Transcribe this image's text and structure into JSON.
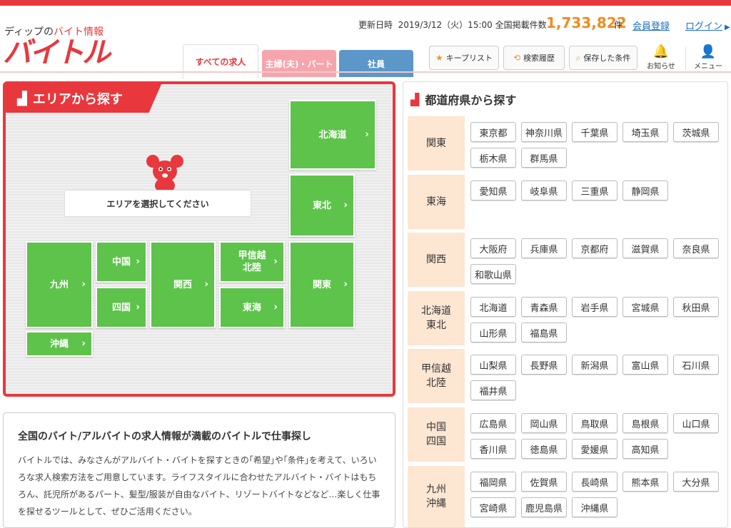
{
  "header": {
    "logo_sub_prefix": "ディップの",
    "logo_sub_red": "バイト情報",
    "logo_main": "バイトル",
    "update_label": "更新日時",
    "update_date": "2019/3/12（火）15:00",
    "count_label": "全国掲載件数",
    "count_value": "1,733,822",
    "count_unit": "件",
    "register": "会員登録",
    "login": "ログイン",
    "tabs": [
      "すべての求人",
      "主婦(夫)・パート",
      "社員"
    ],
    "tools": [
      "キープリスト",
      "検索履歴",
      "保存した条件"
    ],
    "notice": "お知らせ",
    "menu": "メニュー",
    "colors": {
      "brand": "#e8383d",
      "count": "#f08c1e",
      "link": "#1d6fc2"
    }
  },
  "area": {
    "title": "エリアから探す",
    "select_msg": "エリアを選択してください",
    "regions": {
      "hokkaido": "北海道",
      "tohoku": "東北",
      "kanto": "関東",
      "koshinetsu_1": "甲信越",
      "koshinetsu_2": "北陸",
      "tokai": "東海",
      "kansai": "関西",
      "chugoku": "中国",
      "shikoku": "四国",
      "kyushu": "九州",
      "okinawa": "沖縄"
    },
    "region_color": "#5dc34a"
  },
  "info": {
    "title": "全国のバイト/アルバイトの求人情報が満載のバイトルで仕事探し",
    "body": "バイトルでは、みなさんがアルバイト・バイトを探すときの｢希望｣や｢条件｣を考えて、いろいろな求人検索方法をご用意しています。ライフスタイルに合わせたアルバイト・バイトはもちろん、託児所があるパート、髪型/服装が自由なバイト、リゾートバイトなどなど…楽しく仕事を探せるツールとして、ぜひご活用ください。"
  },
  "prefs": {
    "title": "都道府県から探す",
    "groups": [
      {
        "label": "関東",
        "items": [
          "東京都",
          "神奈川県",
          "千葉県",
          "埼玉県",
          "茨城県",
          "栃木県",
          "群馬県"
        ]
      },
      {
        "label": "東海",
        "items": [
          "愛知県",
          "岐阜県",
          "三重県",
          "静岡県"
        ]
      },
      {
        "label": "関西",
        "items": [
          "大阪府",
          "兵庫県",
          "京都府",
          "滋賀県",
          "奈良県",
          "和歌山県"
        ]
      },
      {
        "label": "北海道\n東北",
        "items": [
          "北海道",
          "青森県",
          "岩手県",
          "宮城県",
          "秋田県",
          "山形県",
          "福島県"
        ]
      },
      {
        "label": "甲信越\n北陸",
        "items": [
          "山梨県",
          "長野県",
          "新潟県",
          "富山県",
          "石川県",
          "福井県"
        ]
      },
      {
        "label": "中国\n四国",
        "items": [
          "広島県",
          "岡山県",
          "鳥取県",
          "島根県",
          "山口県",
          "香川県",
          "徳島県",
          "愛媛県",
          "高知県"
        ]
      },
      {
        "label": "九州\n沖縄",
        "items": [
          "福岡県",
          "佐賀県",
          "長崎県",
          "熊本県",
          "大分県",
          "宮崎県",
          "鹿児島県",
          "沖縄県"
        ]
      }
    ],
    "label_bg": "#fde6d2"
  }
}
